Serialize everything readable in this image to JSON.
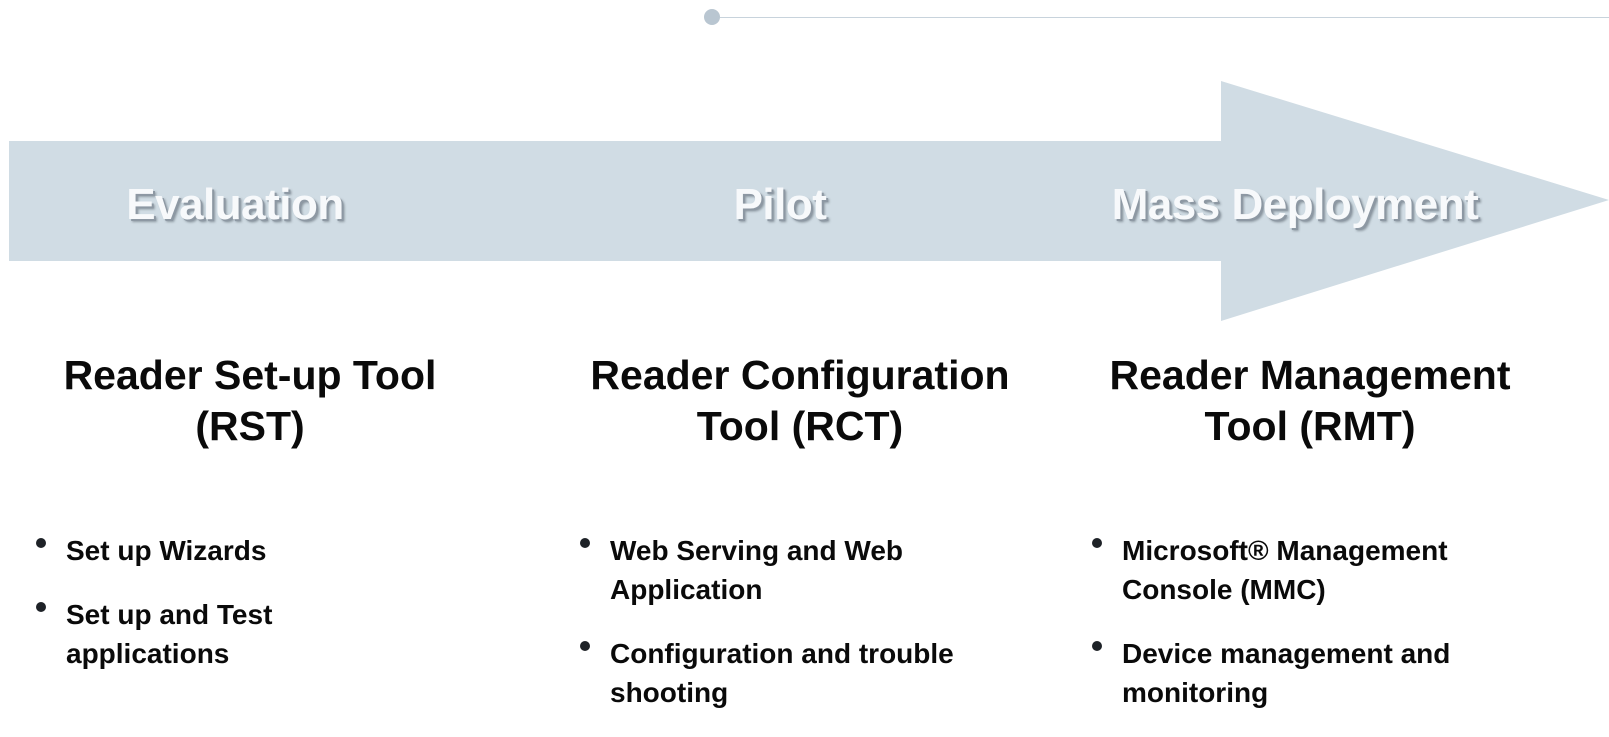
{
  "phases": [
    {
      "label": "Evaluation"
    },
    {
      "label": "Pilot"
    },
    {
      "label": "Mass Deployment"
    }
  ],
  "tools": [
    {
      "title_line1": "Reader Set-up Tool",
      "title_line2": "(RST)",
      "bullets": [
        "Set up Wizards",
        "Set up and Test applications"
      ]
    },
    {
      "title_line1": "Reader Configuration",
      "title_line2": "Tool (RCT)",
      "bullets": [
        "Web Serving and Web Application",
        "Configuration and trouble shooting"
      ]
    },
    {
      "title_line1": "Reader Management",
      "title_line2": "Tool (RMT)",
      "bullets": [
        "Microsoft® Management Console (MMC)",
        "Device management and monitoring"
      ]
    }
  ],
  "colors": {
    "arrow": "#d0dce4",
    "phase_text": "#f7f9fb",
    "body_text": "#0a0a0a"
  }
}
